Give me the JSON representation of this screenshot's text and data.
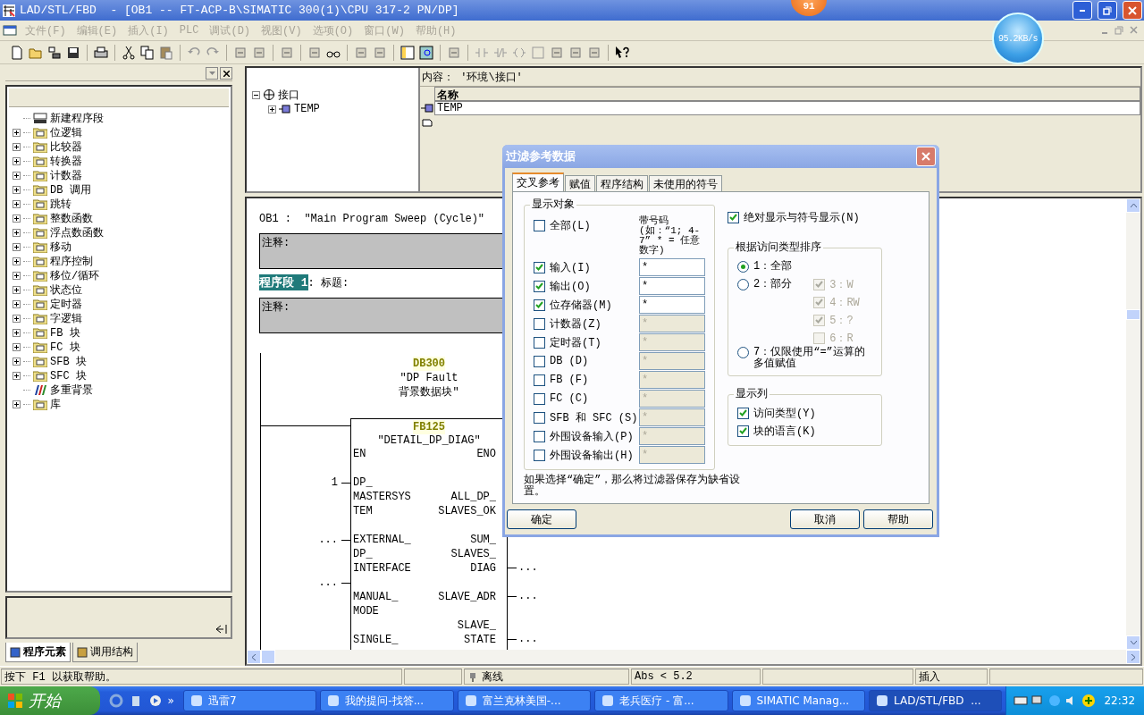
{
  "window": {
    "title": "LAD/STL/FBD  - [OB1 -- FT-ACP-B\\SIMATIC 300(1)\\CPU 317-2 PN/DP]"
  },
  "badge": {
    "text": "91"
  },
  "speed_meter": {
    "text": "95.2KB/s"
  },
  "menu": [
    {
      "label": "文件(F)",
      "disabled": true
    },
    {
      "label": "编辑(E)",
      "disabled": true
    },
    {
      "label": "插入(I)",
      "disabled": true
    },
    {
      "label": "PLC",
      "disabled": true
    },
    {
      "label": "调试(D)",
      "disabled": true
    },
    {
      "label": "视图(V)",
      "disabled": true
    },
    {
      "label": "选项(O)",
      "disabled": true
    },
    {
      "label": "窗口(W)",
      "disabled": true
    },
    {
      "label": "帮助(H)",
      "disabled": true
    }
  ],
  "elements_panel": {
    "items": [
      {
        "label": "新建程序段",
        "kind": "leaf"
      },
      {
        "label": "位逻辑",
        "kind": "folder"
      },
      {
        "label": "比较器",
        "kind": "folder"
      },
      {
        "label": "转换器",
        "kind": "folder"
      },
      {
        "label": "计数器",
        "kind": "folder"
      },
      {
        "label": "DB 调用",
        "kind": "folder"
      },
      {
        "label": "跳转",
        "kind": "folder"
      },
      {
        "label": "整数函数",
        "kind": "folder"
      },
      {
        "label": "浮点数函数",
        "kind": "folder"
      },
      {
        "label": "移动",
        "kind": "folder"
      },
      {
        "label": "程序控制",
        "kind": "folder"
      },
      {
        "label": "移位/循环",
        "kind": "folder"
      },
      {
        "label": "状态位",
        "kind": "folder"
      },
      {
        "label": "定时器",
        "kind": "folder"
      },
      {
        "label": "字逻辑",
        "kind": "folder"
      },
      {
        "label": "FB 块",
        "kind": "folder"
      },
      {
        "label": "FC 块",
        "kind": "folder"
      },
      {
        "label": "SFB 块",
        "kind": "folder"
      },
      {
        "label": "SFC 块",
        "kind": "folder"
      },
      {
        "label": "多重背景",
        "kind": "leaf"
      },
      {
        "label": "库",
        "kind": "folder"
      }
    ],
    "tabs": [
      {
        "label": "程序元素",
        "selected": true
      },
      {
        "label": "调用结构",
        "selected": false
      }
    ]
  },
  "interface": {
    "tree": [
      {
        "label": "接口",
        "expanded": true,
        "children": [
          {
            "label": "TEMP",
            "expanded": false
          }
        ]
      }
    ],
    "content_label": "内容： '环境\\接口'",
    "columns": [
      "名称"
    ],
    "rows": [
      {
        "name": "TEMP"
      }
    ]
  },
  "editor": {
    "block_title": "OB1 :  \"Main Program Sweep (Cycle)\"",
    "block_comment": "注释:",
    "network_label": "程序段 1",
    "network_title": ": 标题:",
    "network_comment": "注释:",
    "instance_db": "DB300",
    "instance_name": "\"DP Fault背景数据块\"",
    "block": "FB125",
    "block_name": "\"DETAIL_DP_DIAG\"",
    "inputs": [
      {
        "lines": [
          "EN"
        ]
      },
      {
        "lines": [
          "DP_",
          "MASTERSYS",
          "TEM"
        ],
        "value": "1"
      },
      {
        "lines": [
          "EXTERNAL_",
          "DP_",
          "INTERFACE"
        ],
        "value": "..."
      },
      {
        "lines": [
          "MANUAL_",
          "MODE"
        ],
        "value": "..."
      },
      {
        "lines": [
          "SINGLE_"
        ]
      }
    ],
    "outputs": [
      {
        "lines": [
          "ENO"
        ]
      },
      {
        "lines": [
          "ALL_DP_",
          "SLAVES_OK"
        ]
      },
      {
        "lines": [
          "SUM_",
          "SLAVES_",
          "DIAG"
        ],
        "value": "..."
      },
      {
        "lines": [
          "SLAVE_ADR"
        ],
        "value": "..."
      },
      {
        "lines": [
          "SLAVE_",
          "STATE"
        ],
        "value": "..."
      }
    ]
  },
  "dialog": {
    "title": "过滤参考数据",
    "tabs": [
      {
        "label": "交叉参考",
        "selected": true
      },
      {
        "label": "赋值",
        "selected": false
      },
      {
        "label": "程序结构",
        "selected": false
      },
      {
        "label": "未使用的符号",
        "selected": false
      }
    ],
    "objects": {
      "title": "显示对象",
      "number_hint": "带号码(如：“1; 4-7” * = 任意数字)",
      "items": [
        {
          "label": "全部(L)",
          "checked": false
        },
        {
          "label": "输入(I)",
          "checked": true,
          "filter": "*"
        },
        {
          "label": "输出(O)",
          "checked": true,
          "filter": "*"
        },
        {
          "label": "位存储器(M)",
          "checked": true,
          "filter": "*"
        },
        {
          "label": "计数器(Z)",
          "checked": false,
          "filter": "*"
        },
        {
          "label": "定时器(T)",
          "checked": false,
          "filter": "*"
        },
        {
          "label": "DB (D)",
          "checked": false,
          "filter": "*"
        },
        {
          "label": "FB (F)",
          "checked": false,
          "filter": "*"
        },
        {
          "label": "FC (C)",
          "checked": false,
          "filter": "*"
        },
        {
          "label": "SFB 和 SFC (S)",
          "checked": false,
          "filter": "*"
        },
        {
          "label": "外围设备输入(P)",
          "checked": false,
          "filter": "*"
        },
        {
          "label": "外围设备输出(H)",
          "checked": false,
          "filter": "*"
        }
      ]
    },
    "absolute_symbolic": {
      "label": "绝对显示与符号显示(N)",
      "checked": true
    },
    "sort": {
      "title": "根据访问类型排序",
      "options": [
        {
          "label": "1：全部",
          "selected": true
        },
        {
          "label": "2：部分",
          "selected": false,
          "sub": [
            {
              "label": "3：W",
              "checked": true,
              "disabled": true
            },
            {
              "label": "4：RW",
              "checked": true,
              "disabled": true
            },
            {
              "label": "5：?",
              "checked": true,
              "disabled": true
            },
            {
              "label": "6：R",
              "checked": false,
              "disabled": true
            }
          ]
        },
        {
          "label": "7：仅限使用“=”运算的多值赋值",
          "selected": false
        }
      ]
    },
    "columns": {
      "title": "显示列",
      "items": [
        {
          "label": "访问类型(Y)",
          "checked": true
        },
        {
          "label": "块的语言(K)",
          "checked": true
        }
      ]
    },
    "note": "如果选择“确定”，那么将过滤器保存为缺省设置。",
    "buttons": [
      "确定",
      "取消",
      "帮助"
    ]
  },
  "status_bar": {
    "help": "按下 F1 以获取帮助。",
    "mode": "离线",
    "address": "Abs < 5.2",
    "edit_mode": "插入"
  },
  "taskbar": {
    "start": "开始",
    "more": "»",
    "tasks": [
      {
        "label": "迅雷7",
        "selected": false
      },
      {
        "label": "我的提问-找答...",
        "selected": false
      },
      {
        "label": "富兰克林美国-...",
        "selected": false
      },
      {
        "label": "老兵医疗 - 富...",
        "selected": false
      },
      {
        "label": "SIMATIC Manag...",
        "selected": false
      },
      {
        "label": "LAD/STL/FBD  ...",
        "selected": true
      }
    ],
    "clock": "22:32"
  }
}
